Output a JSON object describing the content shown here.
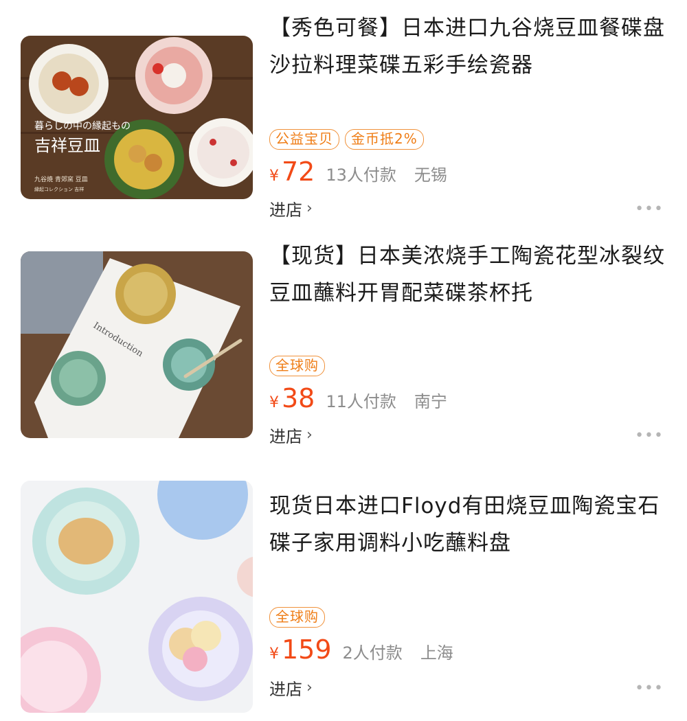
{
  "products": [
    {
      "title": "【秀色可餐】日本进口九谷烧豆皿餐碟盘沙拉料理菜碟五彩手绘瓷器",
      "tags": [
        "公益宝贝",
        "金币抵2%"
      ],
      "currency": "¥",
      "price": "72",
      "sold": "13人付款",
      "location": "无锡",
      "shop_label": "进店",
      "image_text": {
        "line1": "暮らしの中の縁起もの",
        "line2": "吉祥豆皿",
        "line3": "九谷焼 青郊窯 豆皿",
        "line4": "縁起コレクション 吉祥"
      }
    },
    {
      "title": "【现货】日本美浓烧手工陶瓷花型冰裂纹豆皿蘸料开胃配菜碟茶杯托",
      "tags": [
        "全球购"
      ],
      "currency": "¥",
      "price": "38",
      "sold": "11人付款",
      "location": "南宁",
      "shop_label": "进店",
      "image_text": {
        "card": "Introduction"
      }
    },
    {
      "title": "现货日本进口Floyd有田烧豆皿陶瓷宝石碟子家用调料小吃蘸料盘",
      "tags": [
        "全球购"
      ],
      "currency": "¥",
      "price": "159",
      "sold": "2人付款",
      "location": "上海",
      "shop_label": "进店"
    }
  ],
  "icons": {
    "chevron": "chevron-right-icon",
    "more": "more-dots-icon"
  },
  "more_glyph": "•••",
  "chevron_glyph": "›",
  "colors": {
    "price": "#f24a17",
    "tag_border": "#f0913a",
    "muted": "#8c8c8c"
  }
}
